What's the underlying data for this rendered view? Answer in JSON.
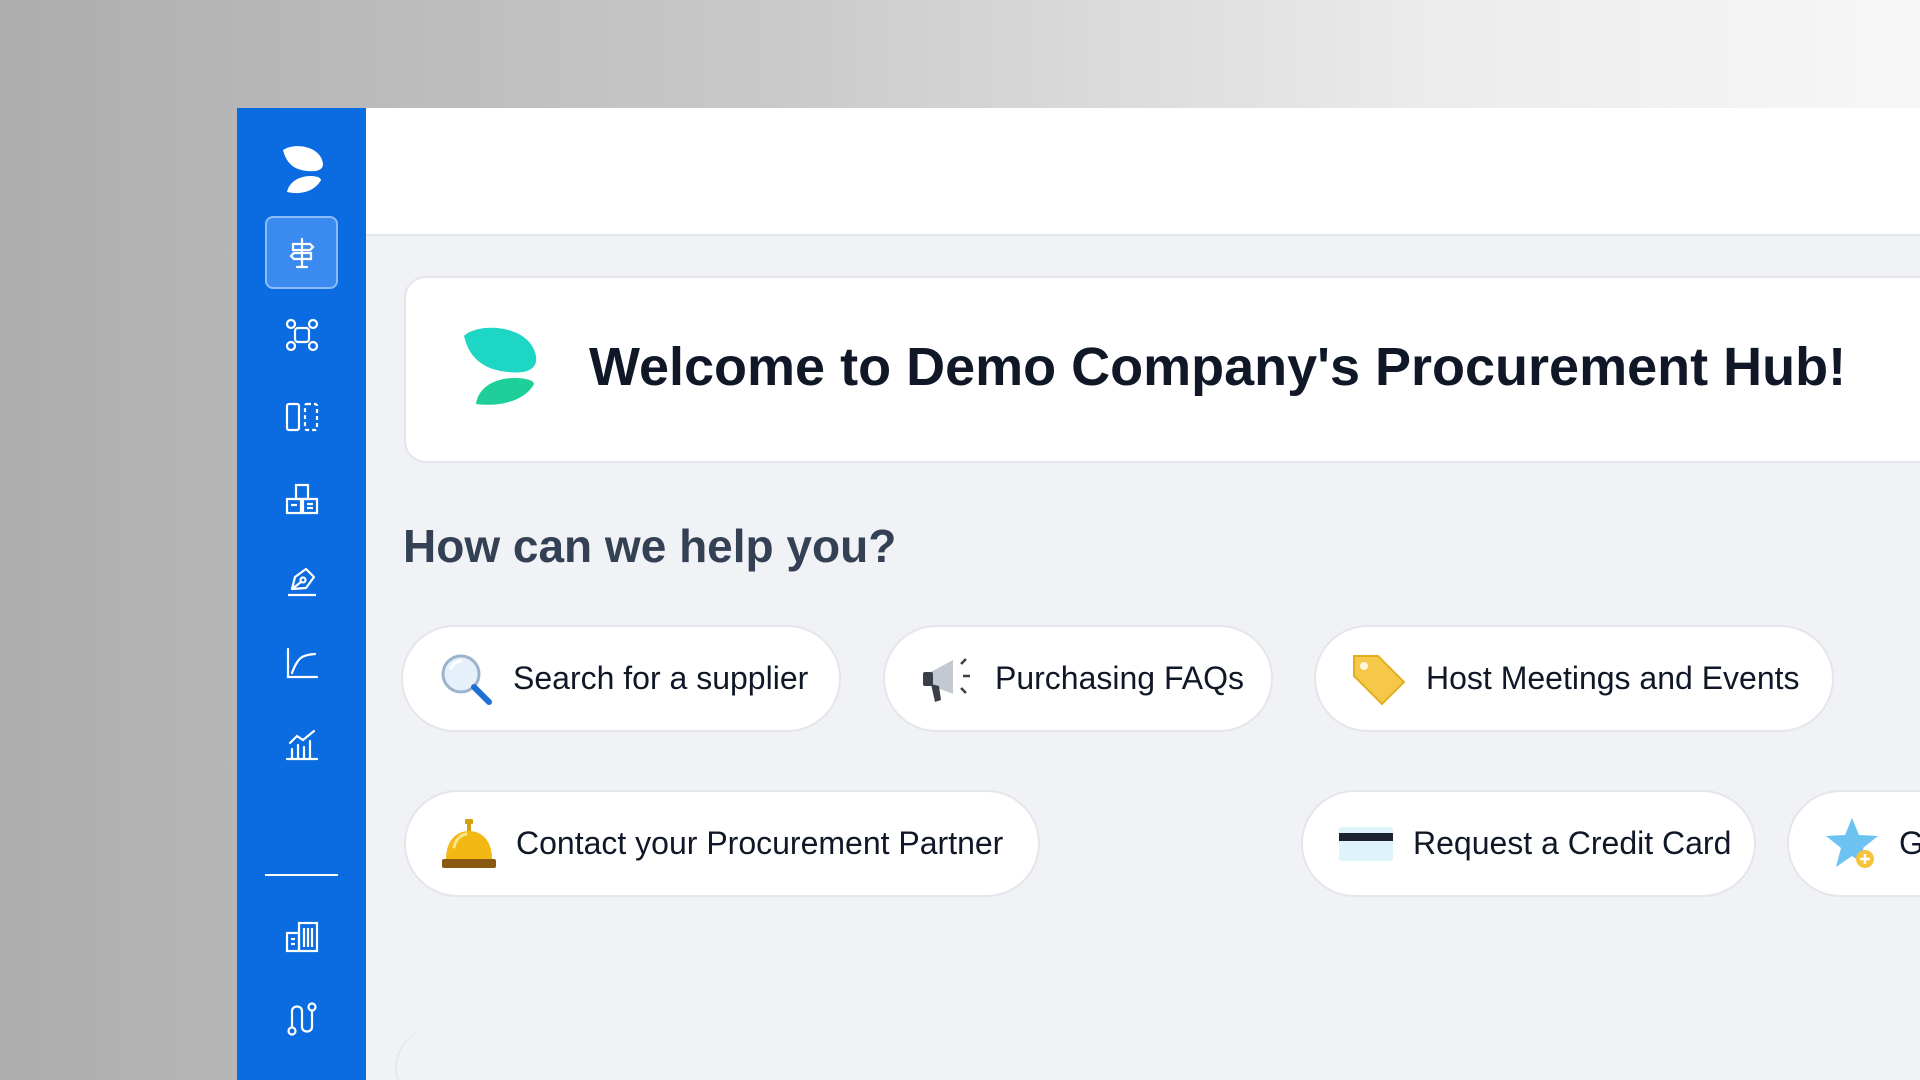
{
  "app": {
    "welcome_title": "Welcome to Demo Company's Procurement Hub!",
    "help_heading": "How can we help you?"
  },
  "sidebar": {
    "items": [
      {
        "icon": "signpost-icon",
        "active": true
      },
      {
        "icon": "network-icon",
        "active": false
      },
      {
        "icon": "compare-columns-icon",
        "active": false
      },
      {
        "icon": "buildings-icon",
        "active": false
      },
      {
        "icon": "pen-sign-icon",
        "active": false
      },
      {
        "icon": "line-chart-icon",
        "active": false
      },
      {
        "icon": "bar-chart-icon",
        "active": false
      }
    ],
    "bottom_items": [
      {
        "icon": "office-building-icon"
      },
      {
        "icon": "workflow-route-icon"
      }
    ]
  },
  "actions": [
    {
      "label": "Search for a supplier",
      "icon": "magnifier-icon"
    },
    {
      "label": "Purchasing FAQs",
      "icon": "megaphone-icon"
    },
    {
      "label": "Host Meetings and Events",
      "icon": "tag-icon"
    },
    {
      "label": "Contact your Procurement Partner",
      "icon": "service-bell-icon"
    },
    {
      "label": "Request a Credit Card",
      "icon": "credit-card-icon"
    },
    {
      "label": "Guided Buying",
      "icon": "star-plus-icon"
    }
  ],
  "colors": {
    "sidebar": "#0a6ce0",
    "brand_teal": "#1dd6c4",
    "brand_green": "#1fcf9a"
  }
}
